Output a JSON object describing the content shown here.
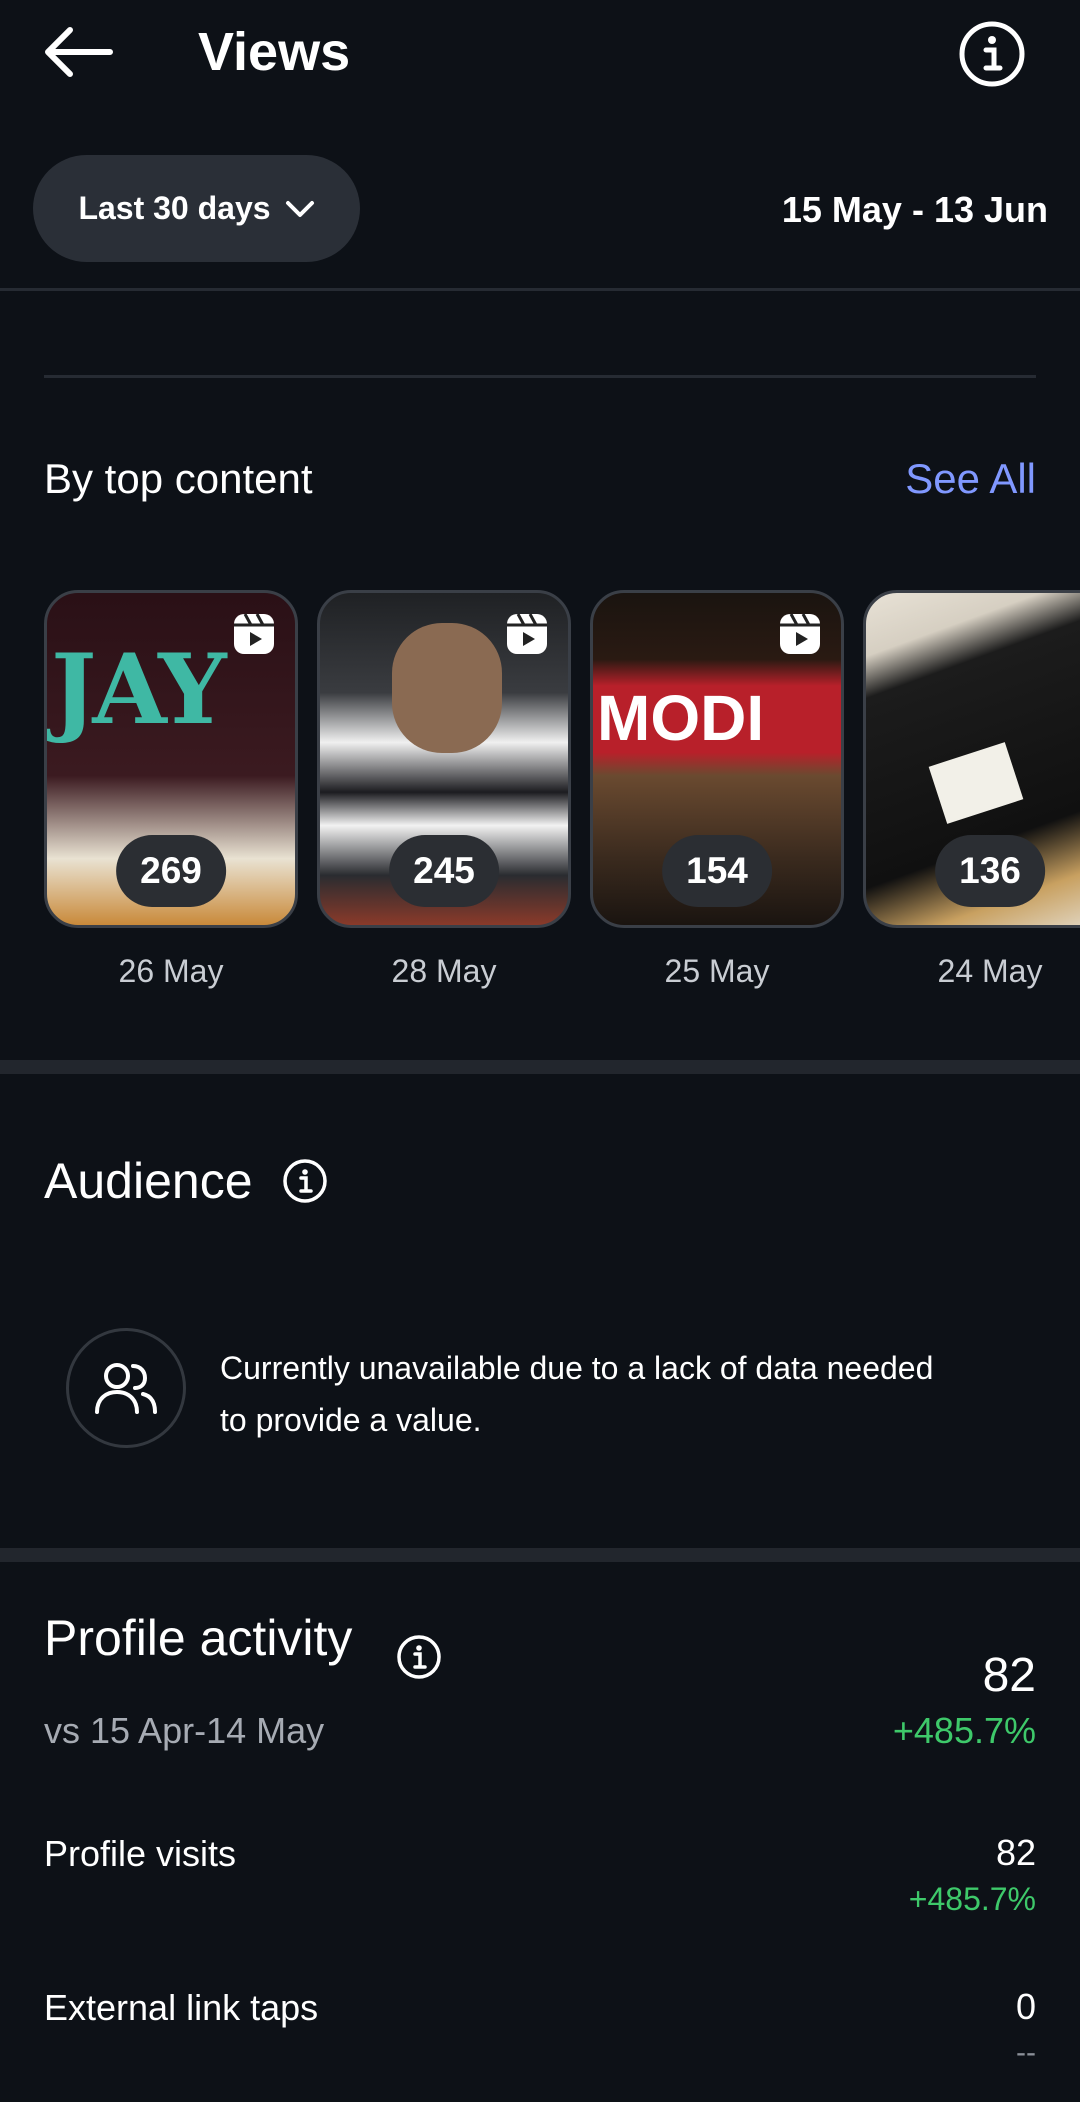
{
  "header": {
    "title": "Views",
    "range_label": "Last 30 days",
    "date_range": "15 May - 13 Jun"
  },
  "top_content": {
    "title": "By top content",
    "see_all": "See All",
    "items": [
      {
        "count": "269",
        "date": "26 May",
        "thumb_text": "JAY",
        "thumb_colors": [
          "#2a1016",
          "#5a1d24"
        ]
      },
      {
        "count": "245",
        "date": "28 May",
        "thumb_text": "",
        "thumb_colors": [
          "#3b3d40",
          "#1c1e20"
        ]
      },
      {
        "count": "154",
        "date": "25 May",
        "thumb_text": "MODI",
        "thumb_colors": [
          "#2a1a10",
          "#6a3a24"
        ]
      },
      {
        "count": "136",
        "date": "24 May",
        "thumb_text": "",
        "thumb_colors": [
          "#d8d2c6",
          "#1a1a1a"
        ]
      }
    ]
  },
  "audience": {
    "title": "Audience",
    "message": "Currently unavailable due to a lack of data needed to provide a value."
  },
  "profile_activity": {
    "title": "Profile activity",
    "comparison": "vs 15 Apr-14 May",
    "total": "82",
    "total_delta": "+485.7%",
    "rows": [
      {
        "label": "Profile visits",
        "value": "82",
        "delta": "+485.7%"
      },
      {
        "label": "External link taps",
        "value": "0",
        "delta": "--"
      }
    ]
  },
  "colors": {
    "background": "#0d1117",
    "accent": "#8098ff",
    "positive": "#3ec96a"
  }
}
